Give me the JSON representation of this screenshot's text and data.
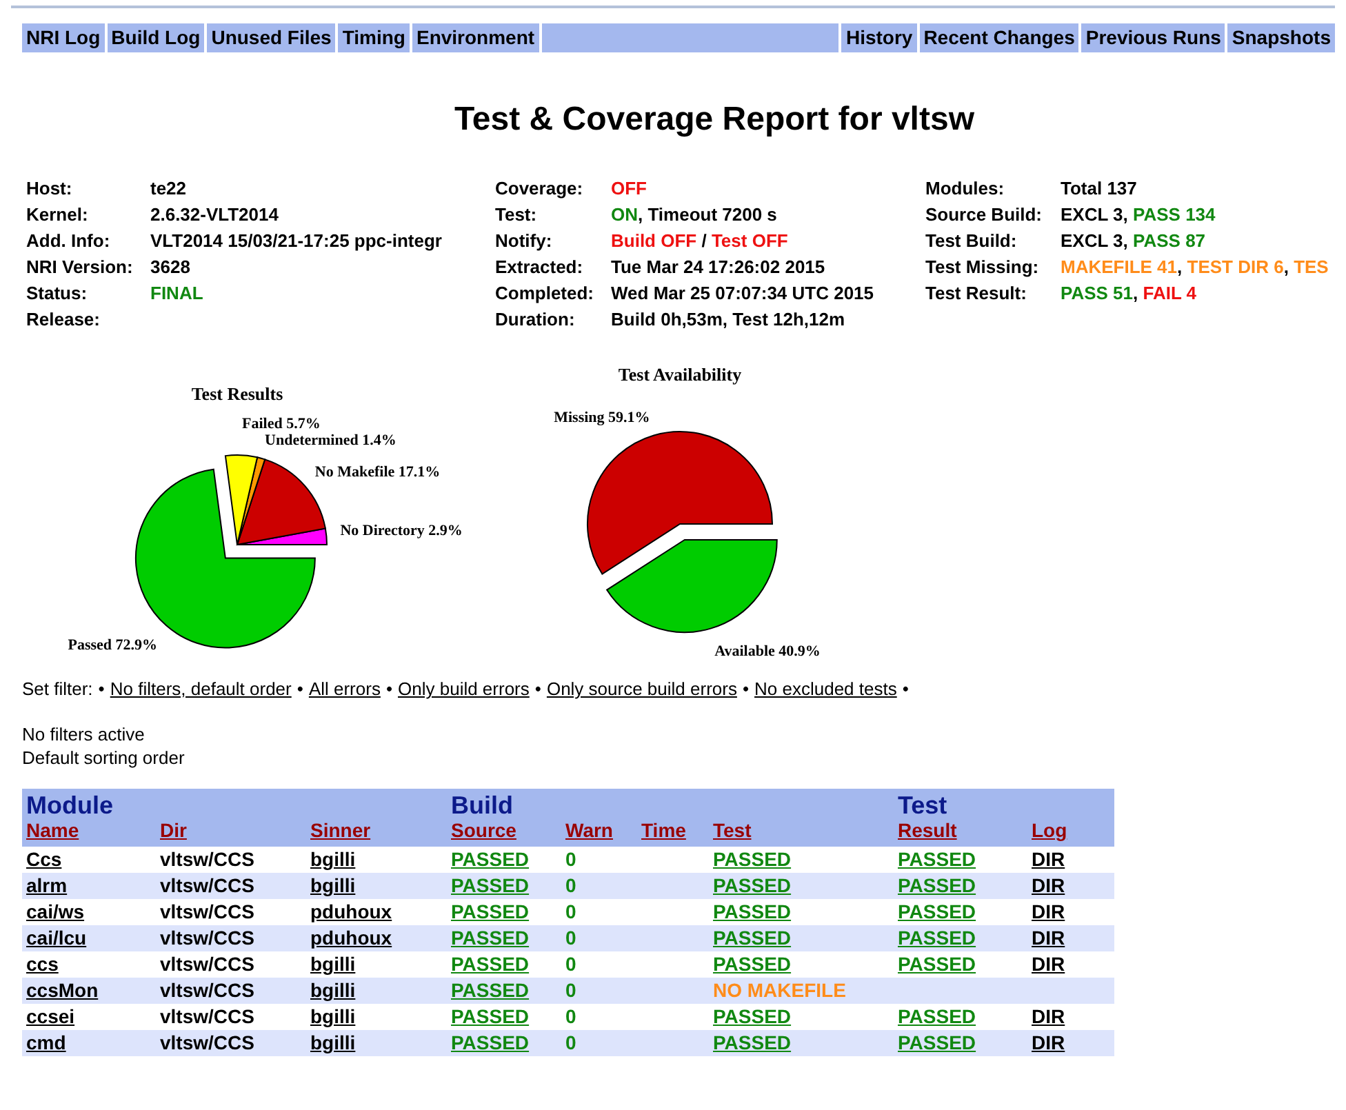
{
  "nav": {
    "left": [
      "NRI Log",
      "Build Log",
      "Unused Files",
      "Timing",
      "Environment"
    ],
    "right": [
      "History",
      "Recent Changes",
      "Previous Runs",
      "Snapshots"
    ]
  },
  "title": "Test & Coverage Report for vltsw",
  "info": [
    [
      {
        "label": "Host:",
        "value": [
          {
            "text": "te22",
            "kind": "plain"
          }
        ]
      },
      {
        "label": "Kernel:",
        "value": [
          {
            "text": "2.6.32-VLT2014",
            "kind": "plain"
          }
        ]
      },
      {
        "label": "Add. Info:",
        "value": [
          {
            "text": "VLT2014 15/03/21-17:25 ppc-integr",
            "kind": "plain"
          }
        ]
      },
      {
        "label": "NRI Version:",
        "value": [
          {
            "text": "3628",
            "kind": "plain"
          }
        ]
      },
      {
        "label": "Status:",
        "value": [
          {
            "text": "FINAL",
            "kind": "ok"
          }
        ]
      },
      {
        "label": "Release:"
      }
    ],
    [
      {
        "label": "Coverage:",
        "value": [
          {
            "text": "OFF",
            "kind": "bad"
          }
        ]
      },
      {
        "label": "Test:",
        "value": [
          {
            "text": "ON",
            "kind": "ok"
          },
          {
            "text": ", Timeout 7200 s",
            "kind": "plain"
          }
        ]
      },
      {
        "label": "Notify:",
        "value": [
          {
            "text": "Build OFF",
            "kind": "bad"
          },
          {
            "text": " / ",
            "kind": "plain"
          },
          {
            "text": "Test OFF",
            "kind": "bad"
          }
        ]
      },
      {
        "label": "Extracted:",
        "value": [
          {
            "text": "Tue Mar 24 17:26:02 2015",
            "kind": "plain"
          }
        ]
      },
      {
        "label": "Completed:",
        "value": [
          {
            "text": "Wed Mar 25 07:07:34 UTC 2015",
            "kind": "plain"
          }
        ]
      },
      {
        "label": "Duration:",
        "value": [
          {
            "text": "Build 0h,53m, Test 12h,12m",
            "kind": "plain"
          }
        ]
      }
    ],
    [
      {
        "label": "Modules:",
        "value": [
          {
            "text": "Total 137",
            "kind": "plain"
          }
        ]
      },
      {
        "label": "Source Build:",
        "value": [
          {
            "text": "EXCL 3",
            "kind": "plain"
          },
          {
            "text": ", ",
            "kind": "plain"
          },
          {
            "text": "PASS 134",
            "kind": "ok"
          }
        ]
      },
      {
        "label": "Test Build:",
        "value": [
          {
            "text": "EXCL 3",
            "kind": "plain"
          },
          {
            "text": ", ",
            "kind": "plain"
          },
          {
            "text": "PASS 87",
            "kind": "ok"
          }
        ]
      },
      {
        "label": "Test Missing:",
        "value": [
          {
            "text": "MAKEFILE 41",
            "kind": "warn"
          },
          {
            "text": ", ",
            "kind": "plain"
          },
          {
            "text": "TEST DIR 6",
            "kind": "warn"
          },
          {
            "text": ", ",
            "kind": "plain"
          },
          {
            "text": "TES",
            "kind": "warn"
          }
        ]
      },
      {
        "label": "Test Result:",
        "value": [
          {
            "text": "PASS 51",
            "kind": "ok"
          },
          {
            "text": ", ",
            "kind": "plain"
          },
          {
            "text": "FAIL 4",
            "kind": "bad"
          }
        ]
      }
    ]
  ],
  "charts": [
    {
      "chart_data": {
        "type": "pie",
        "title": "Test Results",
        "categories": [
          "No Directory",
          "No Makefile",
          "Undetermined",
          "Failed",
          "Passed"
        ],
        "values": [
          2.9,
          17.1,
          1.4,
          5.7,
          72.9
        ],
        "colors": [
          "#ff00ff",
          "#cc0000",
          "#ff9900",
          "#ffff00",
          "#00cc00"
        ],
        "value_labels": [
          "2.9%",
          "17.1%",
          "1.4%",
          "5.7%",
          "72.9%"
        ]
      }
    },
    {
      "chart_data": {
        "type": "pie",
        "title": "Test Availability",
        "categories": [
          "Missing",
          "Available"
        ],
        "values": [
          59.1,
          40.9
        ],
        "colors": [
          "#cc0000",
          "#00cc00"
        ],
        "value_labels": [
          "59.1%",
          "40.9%"
        ]
      }
    }
  ],
  "filter": [
    {
      "kind": "label",
      "text": "Set filter:"
    },
    {
      "kind": "sep",
      "text": "•"
    },
    {
      "kind": "link",
      "text": "No filters, default order"
    },
    {
      "kind": "sep",
      "text": "•"
    },
    {
      "kind": "link",
      "text": "All errors"
    },
    {
      "kind": "sep",
      "text": "•"
    },
    {
      "kind": "link",
      "text": "Only build errors"
    },
    {
      "kind": "sep",
      "text": "•"
    },
    {
      "kind": "link",
      "text": "Only source build errors"
    },
    {
      "kind": "sep",
      "text": "•"
    },
    {
      "kind": "link",
      "text": "No excluded tests"
    },
    {
      "kind": "sep",
      "text": "•"
    }
  ],
  "notes": [
    "No filters active",
    "Default sorting order"
  ],
  "table": {
    "groups": [
      {
        "label": "Module",
        "columns": [
          "Name",
          "Dir",
          "Sinner"
        ]
      },
      {
        "label": "Build",
        "columns": [
          "Source",
          "Warn",
          "Time",
          "Test"
        ]
      },
      {
        "label": "Test",
        "columns": [
          "Result",
          "Log"
        ]
      }
    ],
    "rows": [
      {
        "name": "Ccs",
        "dir": "vltsw/CCS",
        "sinner": "bgilli",
        "source": {
          "text": "PASSED",
          "kind": "pass"
        },
        "warn": "0",
        "test": {
          "text": "PASSED",
          "kind": "pass"
        },
        "result": {
          "text": "PASSED",
          "kind": "pass"
        },
        "log": "DIR"
      },
      {
        "name": "alrm",
        "dir": "vltsw/CCS",
        "sinner": "bgilli",
        "source": {
          "text": "PASSED",
          "kind": "pass"
        },
        "warn": "0",
        "test": {
          "text": "PASSED",
          "kind": "pass"
        },
        "result": {
          "text": "PASSED",
          "kind": "pass"
        },
        "log": "DIR"
      },
      {
        "name": "cai/ws",
        "dir": "vltsw/CCS",
        "sinner": "pduhoux",
        "source": {
          "text": "PASSED",
          "kind": "pass"
        },
        "warn": "0",
        "test": {
          "text": "PASSED",
          "kind": "pass"
        },
        "result": {
          "text": "PASSED",
          "kind": "pass"
        },
        "log": "DIR"
      },
      {
        "name": "cai/lcu",
        "dir": "vltsw/CCS",
        "sinner": "pduhoux",
        "source": {
          "text": "PASSED",
          "kind": "pass"
        },
        "warn": "0",
        "test": {
          "text": "PASSED",
          "kind": "pass"
        },
        "result": {
          "text": "PASSED",
          "kind": "pass"
        },
        "log": "DIR"
      },
      {
        "name": "ccs",
        "dir": "vltsw/CCS",
        "sinner": "bgilli",
        "source": {
          "text": "PASSED",
          "kind": "pass"
        },
        "warn": "0",
        "test": {
          "text": "PASSED",
          "kind": "pass"
        },
        "result": {
          "text": "PASSED",
          "kind": "pass"
        },
        "log": "DIR"
      },
      {
        "name": "ccsMon",
        "dir": "vltsw/CCS",
        "sinner": "bgilli",
        "source": {
          "text": "PASSED",
          "kind": "pass"
        },
        "warn": "0",
        "test": {
          "text": "NO MAKEFILE",
          "kind": "missing"
        }
      },
      {
        "name": "ccsei",
        "dir": "vltsw/CCS",
        "sinner": "bgilli",
        "source": {
          "text": "PASSED",
          "kind": "pass"
        },
        "warn": "0",
        "test": {
          "text": "PASSED",
          "kind": "pass"
        },
        "result": {
          "text": "PASSED",
          "kind": "pass"
        },
        "log": "DIR"
      },
      {
        "name": "cmd",
        "dir": "vltsw/CCS",
        "sinner": "bgilli",
        "source": {
          "text": "PASSED",
          "kind": "pass"
        },
        "warn": "0",
        "test": {
          "text": "PASSED",
          "kind": "pass"
        },
        "result": {
          "text": "PASSED",
          "kind": "pass"
        },
        "log": "DIR"
      }
    ]
  }
}
